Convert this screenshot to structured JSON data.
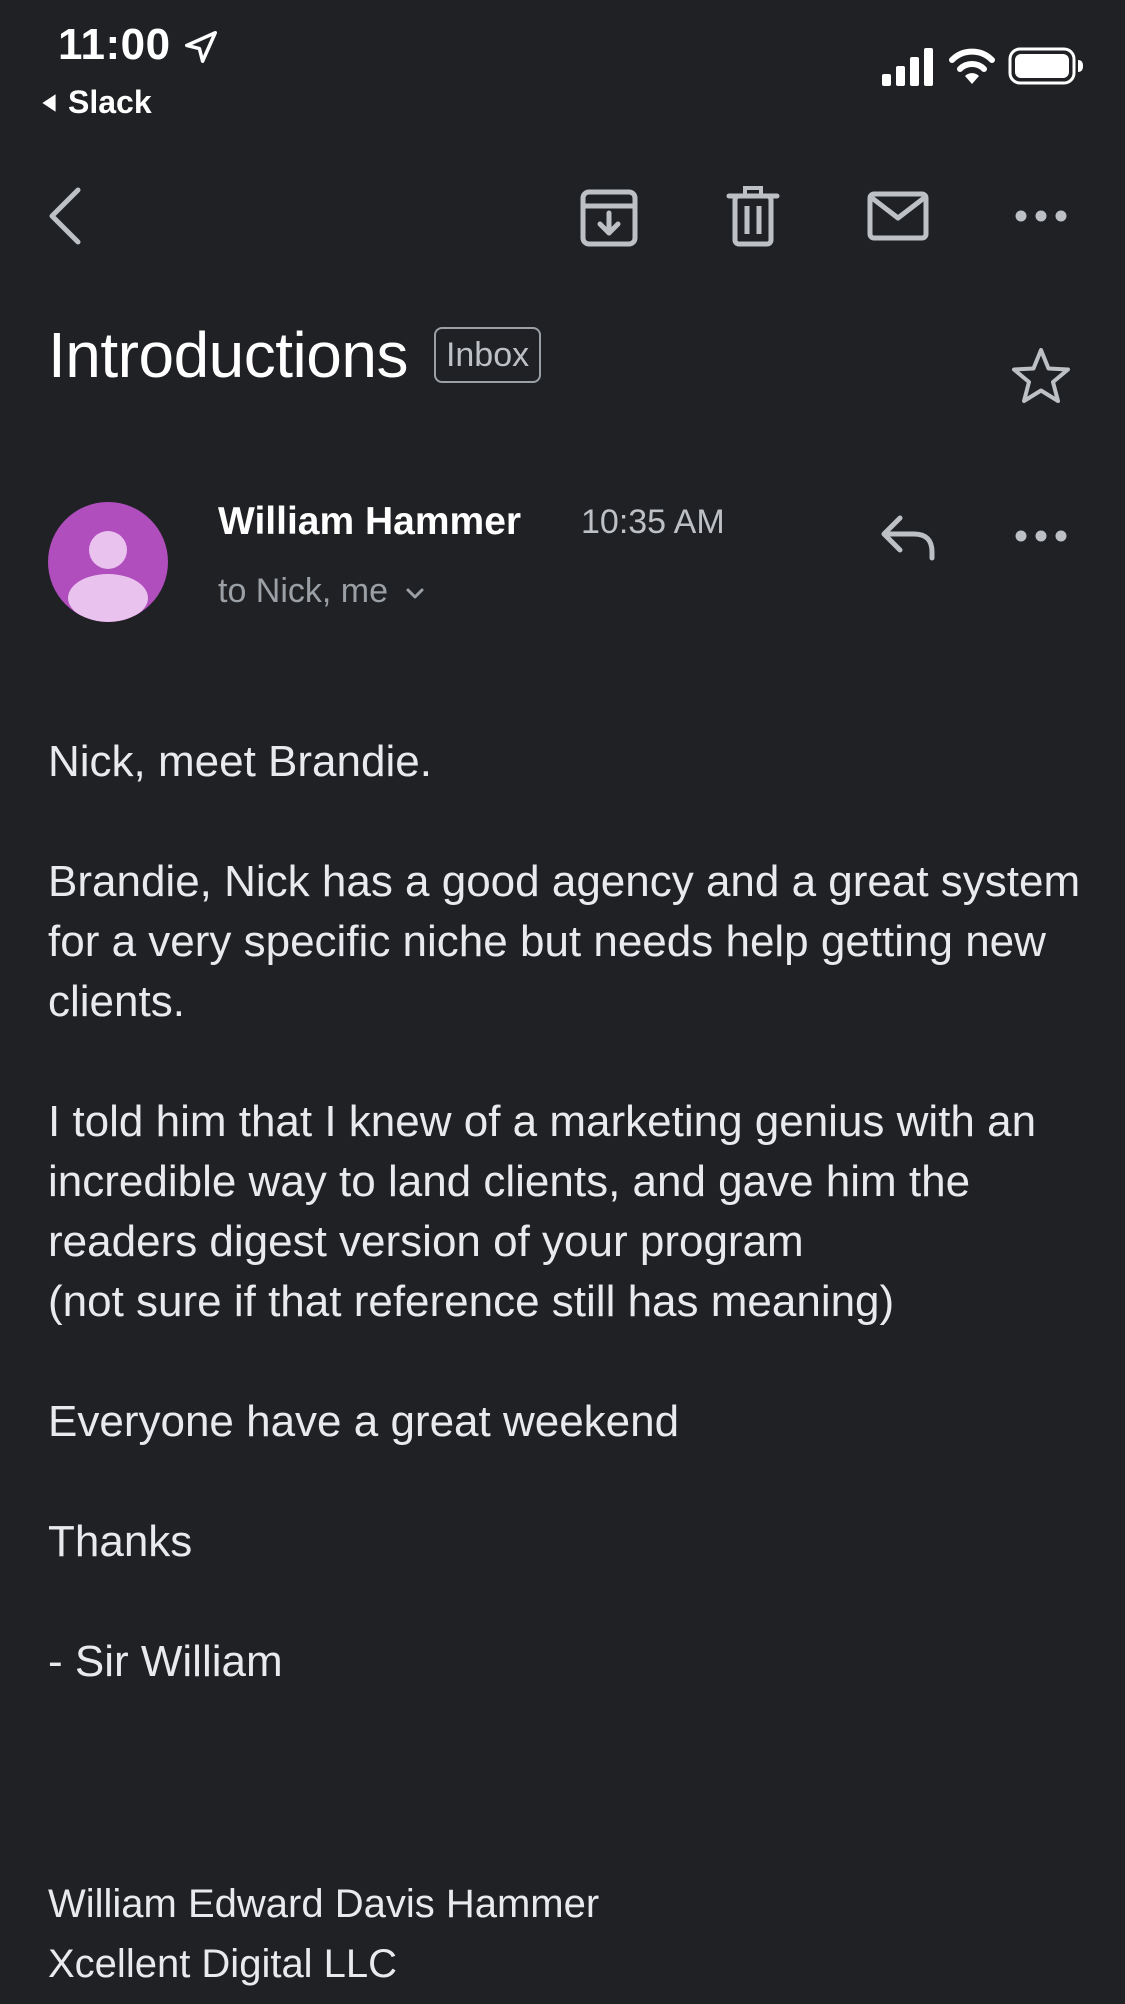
{
  "status_bar": {
    "time": "11:00",
    "back_app": "Slack"
  },
  "toolbar": {
    "back_icon": "back-arrow-icon",
    "archive_icon": "archive-icon",
    "delete_icon": "trash-icon",
    "mark_unread_icon": "mail-icon",
    "more_icon": "more-horizontal-icon"
  },
  "email": {
    "subject": "Introductions",
    "label": "Inbox",
    "sender_name": "William Hammer",
    "time": "10:35 AM",
    "recipients": "to Nick, me",
    "avatar_color": "#b04ebe",
    "body": "Nick, meet Brandie.\n\nBrandie, Nick has a good agency and a great system for a very specific niche but needs help getting new clients.\n\nI told him that I knew of a marketing genius with an incredible way to land clients, and gave him the readers digest version of your program\n(not sure if that reference still has meaning)\n\nEveryone have a great weekend\n\nThanks\n\n- Sir William",
    "signature_line1": "William Edward Davis Hammer",
    "signature_line2": "Xcellent Digital LLC"
  },
  "colors": {
    "background": "#202124",
    "text_primary": "#e8eaed",
    "text_secondary": "#9aa0a6",
    "icon": "#bdc1c6"
  }
}
